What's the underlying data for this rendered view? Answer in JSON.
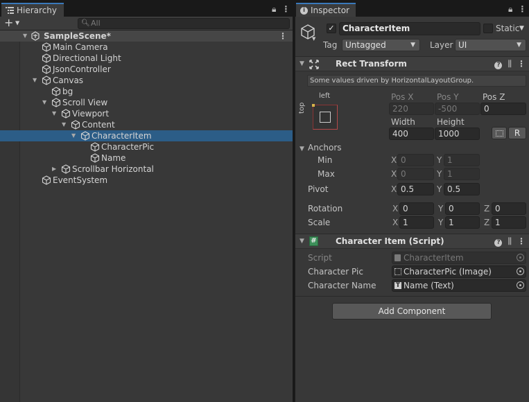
{
  "hierarchy": {
    "tab_label": "Hierarchy",
    "search_placeholder": "All",
    "add_symbol": "+",
    "scene_name": "SampleScene*",
    "items": [
      {
        "label": "Main Camera"
      },
      {
        "label": "Directional Light"
      },
      {
        "label": "JsonController"
      },
      {
        "label": "Canvas"
      },
      {
        "label": "bg"
      },
      {
        "label": "Scroll View"
      },
      {
        "label": "Viewport"
      },
      {
        "label": "Content"
      },
      {
        "label": "CharacterItem"
      },
      {
        "label": "CharacterPic"
      },
      {
        "label": "Name"
      },
      {
        "label": "Scrollbar Horizontal"
      },
      {
        "label": "EventSystem"
      }
    ]
  },
  "inspector": {
    "tab_label": "Inspector",
    "object_name": "CharacterItem",
    "static_label": "Static",
    "tag_label": "Tag",
    "tag_value": "Untagged",
    "layer_label": "Layer",
    "layer_value": "UI",
    "rect_transform": {
      "title": "Rect Transform",
      "note": "Some values driven by HorizontalLayoutGroup.",
      "anchor_left": "left",
      "anchor_top": "top",
      "pos_x_label": "Pos X",
      "pos_y_label": "Pos Y",
      "pos_z_label": "Pos Z",
      "pos_x": "220",
      "pos_y": "-500",
      "pos_z": "0",
      "width_label": "Width",
      "height_label": "Height",
      "width": "400",
      "height": "1000",
      "r_button": "R",
      "anchors_label": "Anchors",
      "min_label": "Min",
      "max_label": "Max",
      "min_x": "0",
      "min_y": "1",
      "max_x": "0",
      "max_y": "1",
      "pivot_label": "Pivot",
      "pivot_x": "0.5",
      "pivot_y": "0.5",
      "rotation_label": "Rotation",
      "rotation_x": "0",
      "rotation_y": "0",
      "rotation_z": "0",
      "scale_label": "Scale",
      "scale_x": "1",
      "scale_y": "1",
      "scale_z": "1",
      "axis_x": "X",
      "axis_y": "Y",
      "axis_z": "Z"
    },
    "script_component": {
      "title": "Character Item (Script)",
      "script_label": "Script",
      "script_value": "CharacterItem",
      "pic_label": "Character Pic",
      "pic_value": "CharacterPic (Image)",
      "name_label": "Character Name",
      "name_value": "Name (Text)"
    },
    "add_component_label": "Add Component"
  },
  "colors": {
    "selection": "#2c5d87",
    "accent_tab": "#3a79bb",
    "panel_bg": "#383838"
  }
}
